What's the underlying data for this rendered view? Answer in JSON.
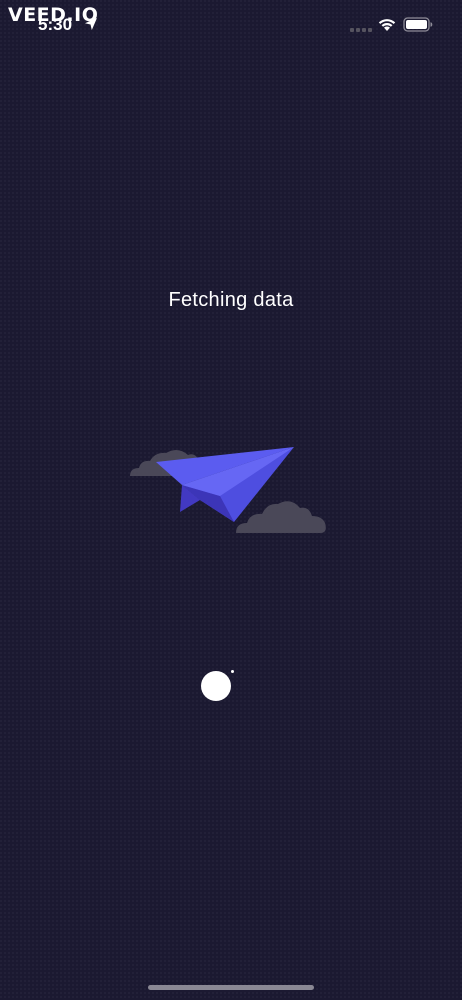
{
  "status_bar": {
    "watermark": "VEED.IO",
    "time": "5:30",
    "icons": [
      "location-arrow-icon",
      "cellular-signal-icon",
      "wifi-icon",
      "battery-icon"
    ]
  },
  "loading": {
    "title": "Fetching data",
    "illustration": "paper-plane-with-clouds",
    "spinner": "loading-spinner"
  },
  "colors": {
    "background": "#1b1931",
    "plane_primary": "#5b5cf0",
    "plane_shadow": "#3c35b8",
    "cloud": "#4a4858",
    "text": "#ffffff"
  }
}
